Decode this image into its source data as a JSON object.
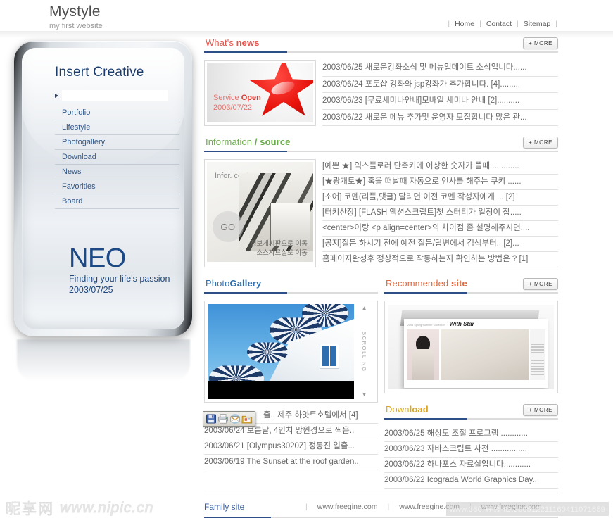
{
  "header": {
    "brand_title": "Mystyle",
    "brand_sub": "my first website",
    "nav": [
      {
        "label": "Home"
      },
      {
        "label": "Contact"
      },
      {
        "label": "Sitemap"
      }
    ],
    "sep": "|"
  },
  "sidebar": {
    "title": "Insert Creative",
    "search_placeholder": "",
    "search_value": "",
    "items": [
      {
        "label": "Portfolio"
      },
      {
        "label": "Lifestyle"
      },
      {
        "label": "Photogallery"
      },
      {
        "label": "Download"
      },
      {
        "label": "News"
      },
      {
        "label": "Favorities"
      },
      {
        "label": "Board"
      }
    ],
    "brand": {
      "name": "NEO",
      "tagline": "Finding your life's passion",
      "date": "2003/07/25"
    }
  },
  "sections": {
    "news": {
      "title_plain": "What's ",
      "title_bold": "news",
      "title_color": "#e9524a",
      "more_label": "+ MORE",
      "thumb": {
        "caption_line1_plain": "Service ",
        "caption_line1_bold": "Open",
        "caption_line2": "2003/07/22"
      },
      "items": [
        {
          "text": "2003/06/25 새로운강좌소식 및 메뉴업데이트 소식입니다......"
        },
        {
          "text": "2003/06/24 포토샵 강좌와 jsp강좌가 추가합니다. [4]........."
        },
        {
          "text": "2003/06/23 [무료세미나안내]모바일 세미나 안내 [2].........."
        },
        {
          "text": "2003/06/22 새로운 메뉴 추가및 운영자 모집합니다 많은 관..."
        }
      ]
    },
    "information": {
      "title_plain": "Information ",
      "title_bold": "/ source",
      "title_color": "#6aab4a",
      "more_label": "+ MORE",
      "thumb": {
        "label": "Infor. center",
        "go_label": "GO",
        "link1": "정보게시판으로 이동",
        "link2": "소스자료실로 이동"
      },
      "items": [
        {
          "text": "[예쁜 ★] 익스플로러 단축키에 이상한 숫자가 뜰때 ............"
        },
        {
          "text": "[★광개토★] 홈을 떠날때 자동으로 인사를 해주는 쿠키 ......"
        },
        {
          "text": "[소어] 코멘(리플,댓글) 달리면 이전 코멘 작성자에게 ... [2]"
        },
        {
          "text": "[터키산장] [FLASH 액션스크립트]첫 스터티가 일정이 잡....."
        },
        {
          "text": "<center>이랑 <p align=center>의 차이점 좀 설명해주시면...."
        },
        {
          "text": "[공지]질문 하시기 전에 예전 질문/답변에서 검색부터.. [2]..."
        },
        {
          "text": "홈페이지완성후 정상적으로 작동하는지 확인하는 방법은 ? [1]"
        }
      ]
    },
    "photogallery": {
      "title_plain": "Photo",
      "title_bold": "Gallery",
      "title_color": "#2f6fb0",
      "scroll_label": "SCROLLING",
      "scroll_up": "▲",
      "scroll_down": "▼",
      "items": [
        {
          "text": "출.. 제주 하얏트호텔에서  [4]"
        },
        {
          "text": "2003/06/24  보름달, 4인치 망원경으로 찍음.."
        },
        {
          "text": "2003/06/21  [Olympus3020Z] 정동진 일출..."
        },
        {
          "text": "2003/06/19  The Sunset at the roof garden.."
        }
      ],
      "ie_toolbar": [
        {
          "name": "save-icon"
        },
        {
          "name": "print-icon"
        },
        {
          "name": "email-icon"
        },
        {
          "name": "open-folder-icon"
        }
      ]
    },
    "recommended": {
      "title_plain": "Recommended ",
      "title_bold": "site",
      "title_color": "#e2663a",
      "more_label": "+ MORE",
      "magazine": {
        "kicker": "2003 Spring/Summer Collection",
        "title": "With Star"
      }
    },
    "download": {
      "title_plain": "Down",
      "title_bold": "load",
      "title_color": "#d8a61f",
      "more_label": "+ MORE",
      "items": [
        {
          "text": "2003/06/25  해상도 조절 프로그램 ............"
        },
        {
          "text": "2003/06/23  자바스크립트 사전 ................"
        },
        {
          "text": "2003/06/22  하나포스 자료실입니다............"
        },
        {
          "text": "2003/06/22  Icograda World Graphics Day.."
        }
      ]
    }
  },
  "family_site": {
    "label": "Family site",
    "sep": "|",
    "links": [
      {
        "label": "www.freegine.com"
      },
      {
        "label": "www.freegine.com"
      },
      {
        "label": "www.freegine.com"
      }
    ]
  },
  "watermarks": {
    "nipic_cjk": "昵享网",
    "nipic_url": "www.nipic.cn",
    "stock_id": "www.360°在线 ID:200512211160411071659"
  }
}
